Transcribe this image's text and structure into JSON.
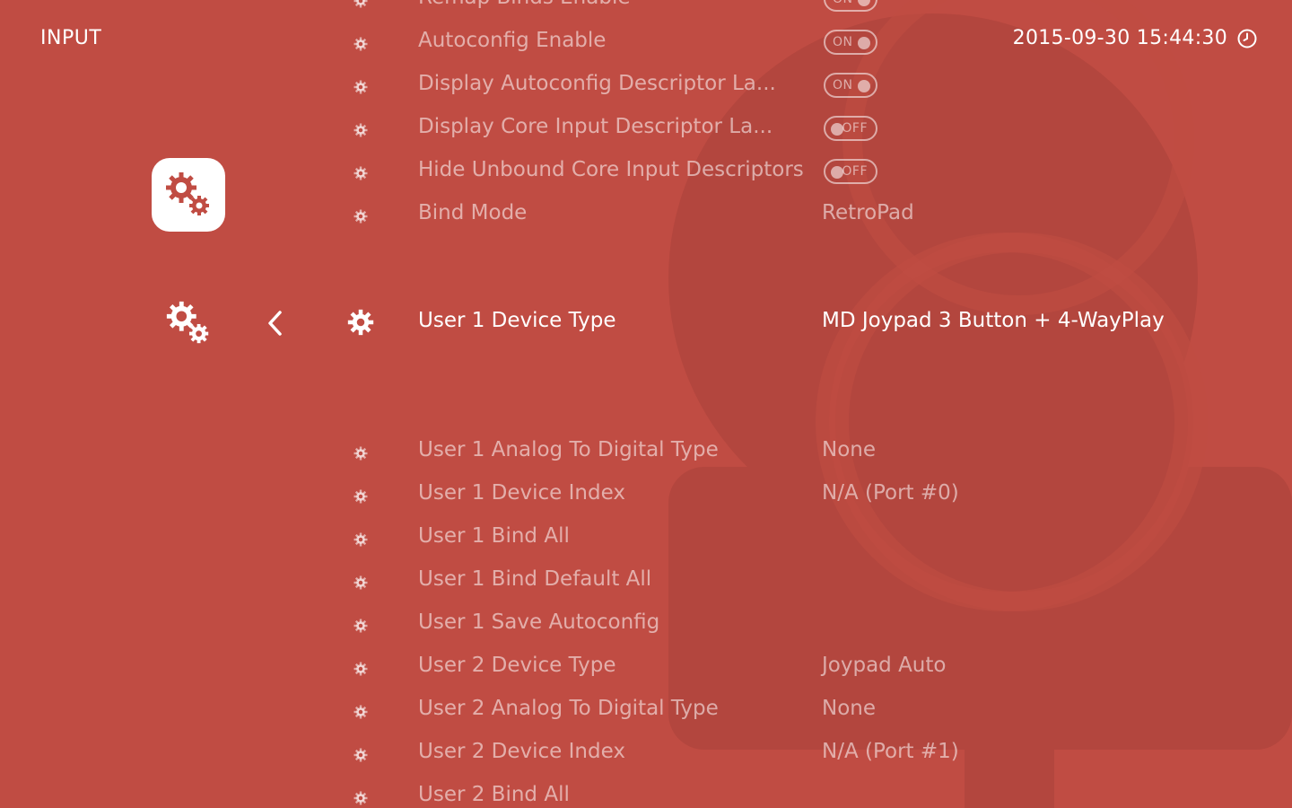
{
  "header": {
    "title": "INPUT",
    "datetime": "2015-09-30 15:44:30",
    "clock_icon": "clock-icon"
  },
  "sidebar": {
    "active_tab_icon": "settings-gears-icon",
    "back_icon": "chevron-left-icon"
  },
  "colors": {
    "background": "#c04c43",
    "accent_dark": "#a9433b",
    "text_active": "#ffffff"
  },
  "menu": {
    "items": [
      {
        "label": "Remap Binds Enable",
        "toggle": "ON"
      },
      {
        "label": "Autoconfig Enable",
        "toggle": "ON"
      },
      {
        "label": "Display Autoconfig Descriptor La...",
        "toggle": "ON"
      },
      {
        "label": "Display Core Input Descriptor La...",
        "toggle": "OFF"
      },
      {
        "label": "Hide Unbound Core Input Descriptors",
        "toggle": "OFF"
      },
      {
        "label": "Bind Mode",
        "value": "RetroPad"
      },
      {
        "label": "User 1 Device Type",
        "value": "MD Joypad 3 Button + 4-WayPlay",
        "selected": true
      },
      {
        "label": "User 1 Analog To Digital Type",
        "value": "None"
      },
      {
        "label": "User 1 Device Index",
        "value": "N/A (Port #0)"
      },
      {
        "label": "User 1 Bind All",
        "value": ""
      },
      {
        "label": "User 1 Bind Default All",
        "value": ""
      },
      {
        "label": "User 1 Save Autoconfig",
        "value": ""
      },
      {
        "label": "User 2 Device Type",
        "value": "Joypad Auto"
      },
      {
        "label": "User 2 Analog To Digital Type",
        "value": "None"
      },
      {
        "label": "User 2 Device Index",
        "value": "N/A (Port #1)"
      },
      {
        "label": "User 2 Bind All",
        "value": ""
      }
    ]
  }
}
